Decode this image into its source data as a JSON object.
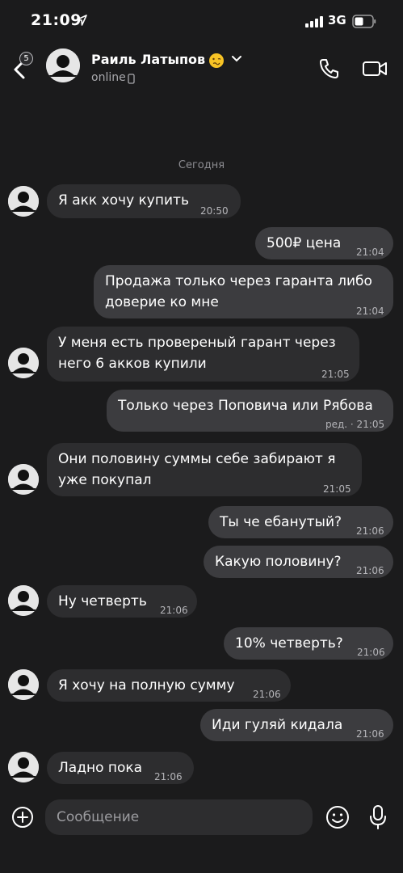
{
  "status_bar": {
    "time": "21:09",
    "network": "3G"
  },
  "header": {
    "back_badge": "5",
    "contact_name": "Раиль Латыпов",
    "contact_status": "online"
  },
  "chat": {
    "date_separator": "Сегодня",
    "messages": [
      {
        "dir": "in",
        "lines": [
          "Я акк хочу купить"
        ],
        "time": "20:50"
      },
      {
        "dir": "out",
        "lines": [
          "500₽ цена"
        ],
        "time": "21:04"
      },
      {
        "dir": "out",
        "lines": [
          "Продажа только через гаранта либо",
          "доверие ко мне"
        ],
        "time": "21:04"
      },
      {
        "dir": "in",
        "lines": [
          "У меня есть провереный гарант через",
          "него 6 акков купили"
        ],
        "time": "21:05"
      },
      {
        "dir": "out",
        "lines": [
          "Только через Поповича или Рябова"
        ],
        "time": "ред. · 21:05"
      },
      {
        "dir": "in",
        "lines": [
          "Они половину суммы себе забирают я",
          "уже покупал"
        ],
        "time": "21:05"
      },
      {
        "dir": "out",
        "lines": [
          "Ты че ебанутый?"
        ],
        "time": "21:06"
      },
      {
        "dir": "out",
        "lines": [
          "Какую половину?"
        ],
        "time": "21:06"
      },
      {
        "dir": "in",
        "lines": [
          "Ну четверть"
        ],
        "time": "21:06"
      },
      {
        "dir": "out",
        "lines": [
          "10% четверть?"
        ],
        "time": "21:06"
      },
      {
        "dir": "in",
        "lines": [
          "Я хочу на полную сумму"
        ],
        "time": "21:06"
      },
      {
        "dir": "out",
        "lines": [
          "Иди гуляй кидала"
        ],
        "time": "21:06"
      },
      {
        "dir": "in",
        "lines": [
          "Ладно пока"
        ],
        "time": "21:06"
      }
    ]
  },
  "composer": {
    "placeholder": "Сообщение"
  },
  "icons": {
    "back": "chevron-left-icon",
    "call": "phone-icon",
    "video": "video-camera-icon",
    "attach": "plus-circle-icon",
    "emoji": "smiley-icon",
    "mic": "microphone-icon"
  },
  "colors": {
    "background": "#1b1b1c",
    "incoming_bubble": "#2d2d2f",
    "outgoing_bubble": "#3c3c3f"
  }
}
